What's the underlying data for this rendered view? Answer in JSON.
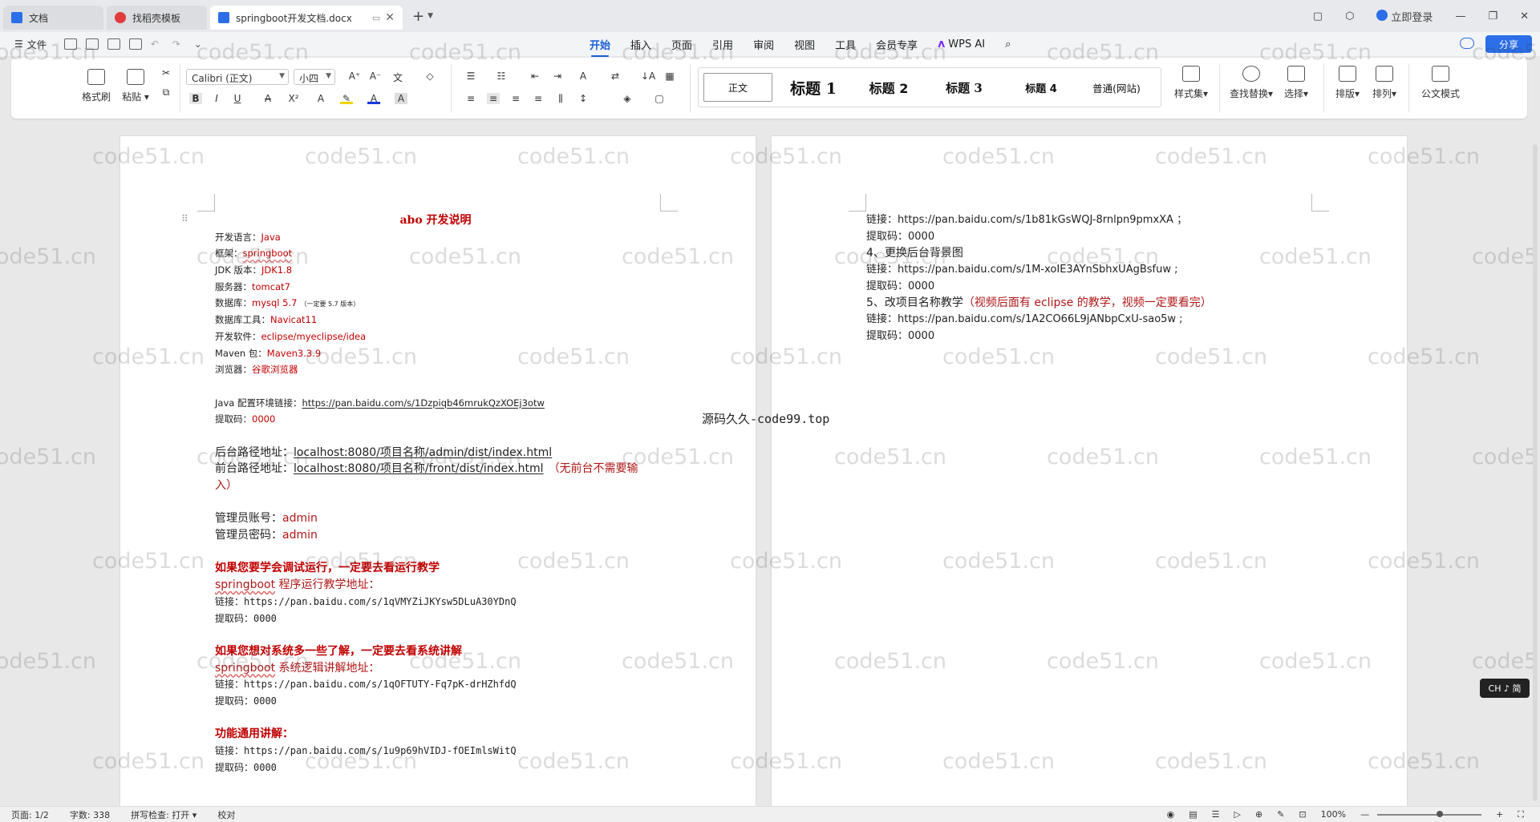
{
  "tabs": [
    {
      "label": "文档",
      "color": "#2b6ee8"
    },
    {
      "label": "找稻壳模板",
      "color": "#e23b3b"
    },
    {
      "label": "springboot开发文档.docx",
      "color": "#2b6ee8"
    }
  ],
  "window": {
    "login": "立即登录"
  },
  "menu": {
    "file": "文件",
    "tabs": [
      "开始",
      "插入",
      "页面",
      "引用",
      "审阅",
      "视图",
      "工具",
      "会员专享"
    ],
    "wps_ai": "WPS AI",
    "share": "分享"
  },
  "ribbon": {
    "format_painter": "格式刷",
    "paste": "粘贴",
    "font_name": "Calibri (正文)",
    "font_size": "小四",
    "styles": [
      "正文",
      "标题 1",
      "标题 2",
      "标题 3",
      "标题 4",
      "普通(网站)"
    ],
    "style_set": "样式集",
    "find_replace": "查找替换",
    "select": "选择",
    "layout": "排版",
    "arrange": "排列",
    "official_mode": "公文模式"
  },
  "doc_left": {
    "title": "abo 开发说明",
    "lines": [
      {
        "label": "开发语言：",
        "value": "Java"
      },
      {
        "label": "框架：",
        "value": "springboot"
      },
      {
        "label": "JDK 版本：",
        "value": "JDK1.8"
      },
      {
        "label": "服务器：",
        "value": "tomcat7"
      },
      {
        "label": "数据库：",
        "value": "mysql 5.7",
        "note": "（一定要 5.7 版本）"
      },
      {
        "label": "数据库工具：",
        "value": "Navicat11"
      },
      {
        "label": "开发软件：",
        "value": "eclipse/myeclipse/idea"
      },
      {
        "label": "Maven 包：",
        "value": "Maven3.3.9"
      },
      {
        "label": "浏览器：",
        "value": "谷歌浏览器"
      }
    ],
    "java_env_label": "Java 配置环境链接：",
    "java_env_url": "https://pan.baidu.com/s/1Dzpiqb46mrukQzXOEj3otw",
    "code_label": "提取码：",
    "code_value": "0000",
    "backend_label": "后台路径地址：",
    "backend_url": "localhost:8080/项目名称/admin/dist/index.html",
    "frontend_label": "前台路径地址：",
    "frontend_url": "localhost:8080/项目名称/front/dist/index.html",
    "frontend_note_1": "（无前台不需要输",
    "frontend_note_2": "入）",
    "admin_user_label": "管理员账号：",
    "admin_user": "admin",
    "admin_pass_label": "管理员密码：",
    "admin_pass": "admin",
    "section1_title": "如果您要学会调试运行，一定要去看运行教学",
    "section1_sub_a": "springboot",
    "section1_sub_b": " 程序运行教学地址：",
    "section1_link": "链接：https://pan.baidu.com/s/1qVMYZiJKYsw5DLuA30YDnQ",
    "section1_code": "提取码：0000",
    "section2_title": "如果您想对系统多一些了解，一定要去看系统讲解",
    "section2_sub_a": "springboot",
    "section2_sub_b": " 系统逻辑讲解地址：",
    "section2_link": "链接：https://pan.baidu.com/s/1qOFTUTY-Fq7pK-drHZhfdQ",
    "section2_code": "提取码：0000",
    "section3_title": "功能通用讲解：",
    "section3_link": "链接：https://pan.baidu.com/s/1u9p69hVIDJ-fOEImlsWitQ",
    "section3_code": "提取码：0000"
  },
  "doc_right": {
    "l1": "链接：https://pan.baidu.com/s/1b81kGsWQJ-8rnlpn9pmxXA ；",
    "l2": "提取码：0000",
    "l3": "4、更换后台背景图",
    "l4": "链接：https://pan.baidu.com/s/1M-xoIE3AYnSbhxUAgBsfuw ;",
    "l5": "提取码：0000",
    "l6a": "5、改项目名称教学",
    "l6b": "（视频后面有 eclipse 的教学，视频一定要看完）",
    "l7": "链接：https://pan.baidu.com/s/1A2CO66L9jANbpCxU-sao5w ;",
    "l8": "提取码：0000"
  },
  "float_text": "源码久久-code99.top",
  "watermark": "code51.cn",
  "ime": "CH ♪ 简",
  "status": {
    "page": "页面: 1/2",
    "words": "字数: 338",
    "spell": "拼写检查: 打开",
    "proof": "校对",
    "zoom": "100%"
  }
}
